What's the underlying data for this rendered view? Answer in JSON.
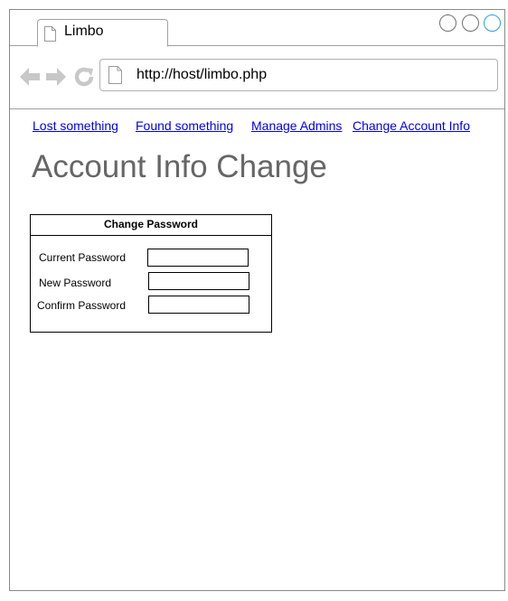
{
  "browser": {
    "tab_title": "Limbo",
    "url": "http://host/limbo.php",
    "window_controls": [
      "circle",
      "circle",
      "circle-accent"
    ],
    "accent_color": "#2a9fd8",
    "icons": {
      "tab": "document-icon",
      "back": "back-arrow-icon",
      "forward": "forward-arrow-icon",
      "reload": "reload-icon",
      "url": "document-icon"
    }
  },
  "nav_links": [
    {
      "label": "Lost something"
    },
    {
      "label": "Found something"
    },
    {
      "label": "Manage Admins"
    },
    {
      "label": "Change Account Info"
    }
  ],
  "page": {
    "title": "Account Info Change"
  },
  "password_panel": {
    "heading": "Change Password",
    "fields": [
      {
        "label": "Current Password",
        "value": "",
        "placeholder": ""
      },
      {
        "label": "New Password",
        "value": "",
        "placeholder": ""
      },
      {
        "label": "Confirm Password",
        "value": "",
        "placeholder": ""
      }
    ]
  },
  "colors": {
    "link": "#0000ee",
    "title": "#666666",
    "border": "#8a8a8a"
  }
}
